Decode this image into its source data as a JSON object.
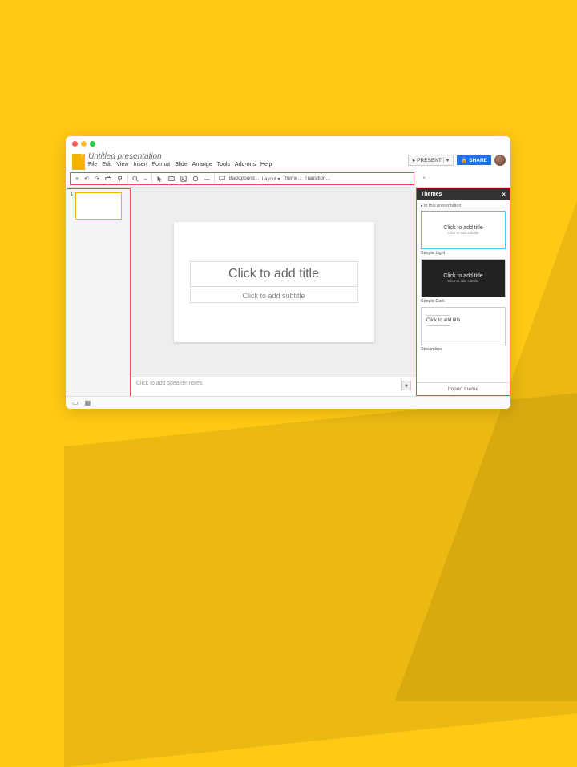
{
  "window": {
    "doc_title": "Untitled presentation",
    "menubar": [
      "File",
      "Edit",
      "View",
      "Insert",
      "Format",
      "Slide",
      "Arrange",
      "Tools",
      "Add-ons",
      "Help"
    ],
    "present_label": "PRESENT",
    "share_label": "SHARE"
  },
  "toolbar": {
    "items": [
      "+",
      "↶",
      "↷",
      "🖨",
      "🖌",
      "|",
      "🔍",
      "–",
      "|",
      "▭",
      "🗔",
      "▭",
      "◯",
      "–",
      "|",
      "🅣"
    ],
    "text_items": [
      "Background…",
      "Layout ▾",
      "Theme…",
      "Transition…"
    ]
  },
  "slide": {
    "title_placeholder": "Click to add title",
    "subtitle_placeholder": "Click to add subtitle"
  },
  "thumbs": {
    "first_index": "1"
  },
  "notes": {
    "placeholder": "Click to add speaker notes"
  },
  "themes": {
    "header": "Themes",
    "section": "In this presentation",
    "card_title": "Click to add title",
    "card_sub": "Click to add subtitle",
    "names": {
      "light": "Simple Light",
      "dark": "Simple Dark",
      "streamline": "Streamline"
    },
    "import": "Import theme"
  }
}
